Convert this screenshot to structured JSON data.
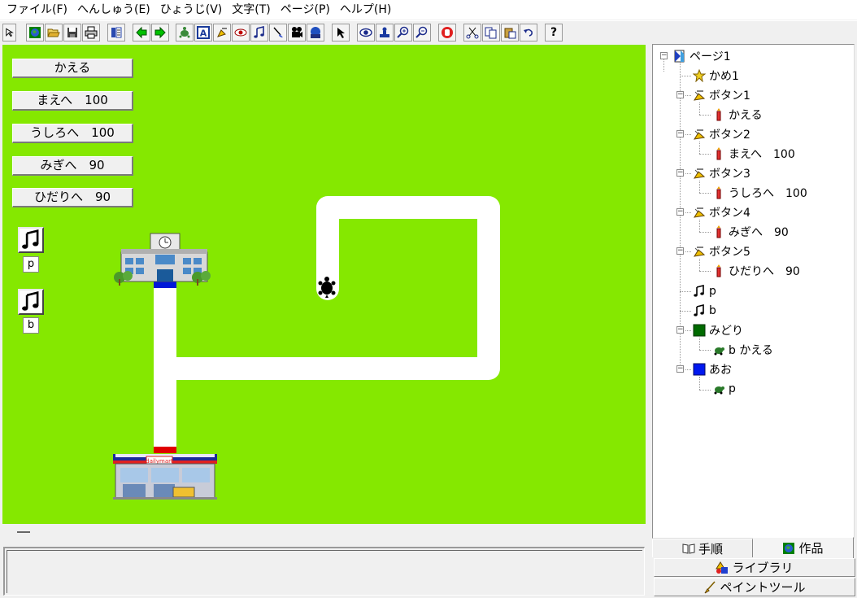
{
  "menu": [
    "ファイル(F)",
    "へんしゅう(E)",
    "ひょうじ(V)",
    "文字(T)",
    "ページ(P)",
    "ヘルプ(H)"
  ],
  "toolbar": {
    "buttons": [
      "pointer-arrow-icon",
      "globe-icon",
      "open-folder-icon",
      "save-icon",
      "print-icon",
      "book-icon",
      "back-arrow-icon",
      "forward-arrow-icon",
      "turtle-add-icon",
      "text-box-icon",
      "button-add-icon",
      "eye-shape-icon",
      "music-note-icon",
      "paint-brush-icon",
      "camera-icon",
      "disk-icon",
      "select-arrow-icon",
      "eye-icon",
      "stamp-icon",
      "zoom-in-icon",
      "zoom-out-icon",
      "stop-hand-icon",
      "cut-icon",
      "copy-icon",
      "paste-icon",
      "undo-icon",
      "help-icon"
    ],
    "help_label": "?"
  },
  "stage": {
    "background": "#85e800",
    "buttons": [
      "かえる",
      "まえへ　100",
      "うしろへ　100",
      "みぎへ　90",
      "ひだりへ　90"
    ],
    "sounds": [
      {
        "icon": "music-note-icon",
        "label": "p"
      },
      {
        "icon": "music-note-icon",
        "label": "b"
      }
    ],
    "school_icon": "school-building-icon",
    "store_icon": "convenience-store-icon",
    "store_sign": "dailymart",
    "turtle_icon": "turtle-icon",
    "markers": {
      "blue": "#0018d8",
      "red": "#e00000"
    }
  },
  "tree": {
    "nodes": [
      {
        "label": "ページ1",
        "icon": "page-icon"
      },
      {
        "label": "かめ1",
        "icon": "turtle-star-icon"
      },
      {
        "label": "ボタン1",
        "icon": "button-icon"
      },
      {
        "label": "かえる",
        "icon": "candle-icon"
      },
      {
        "label": "ボタン2",
        "icon": "button-icon"
      },
      {
        "label": "まえへ　100",
        "icon": "candle-icon"
      },
      {
        "label": "ボタン3",
        "icon": "button-icon"
      },
      {
        "label": "うしろへ　100",
        "icon": "candle-icon"
      },
      {
        "label": "ボタン4",
        "icon": "button-icon"
      },
      {
        "label": "みぎへ　90",
        "icon": "candle-icon"
      },
      {
        "label": "ボタン5",
        "icon": "button-icon"
      },
      {
        "label": "ひだりへ　90",
        "icon": "candle-icon"
      },
      {
        "label": "p",
        "icon": "music-note-icon"
      },
      {
        "label": "b",
        "icon": "music-note-icon"
      },
      {
        "label": "みどり",
        "icon": "green-square-icon",
        "color": "#006b00"
      },
      {
        "label": "b かえる",
        "icon": "turtle-small-icon"
      },
      {
        "label": "あお",
        "icon": "blue-square-icon",
        "color": "#0018f0"
      },
      {
        "label": "p",
        "icon": "turtle-small-icon"
      }
    ]
  },
  "tabs": {
    "procedure": "手順",
    "works": "作品",
    "library": "ライブラリ",
    "paint_tool": "ペイントツール"
  }
}
